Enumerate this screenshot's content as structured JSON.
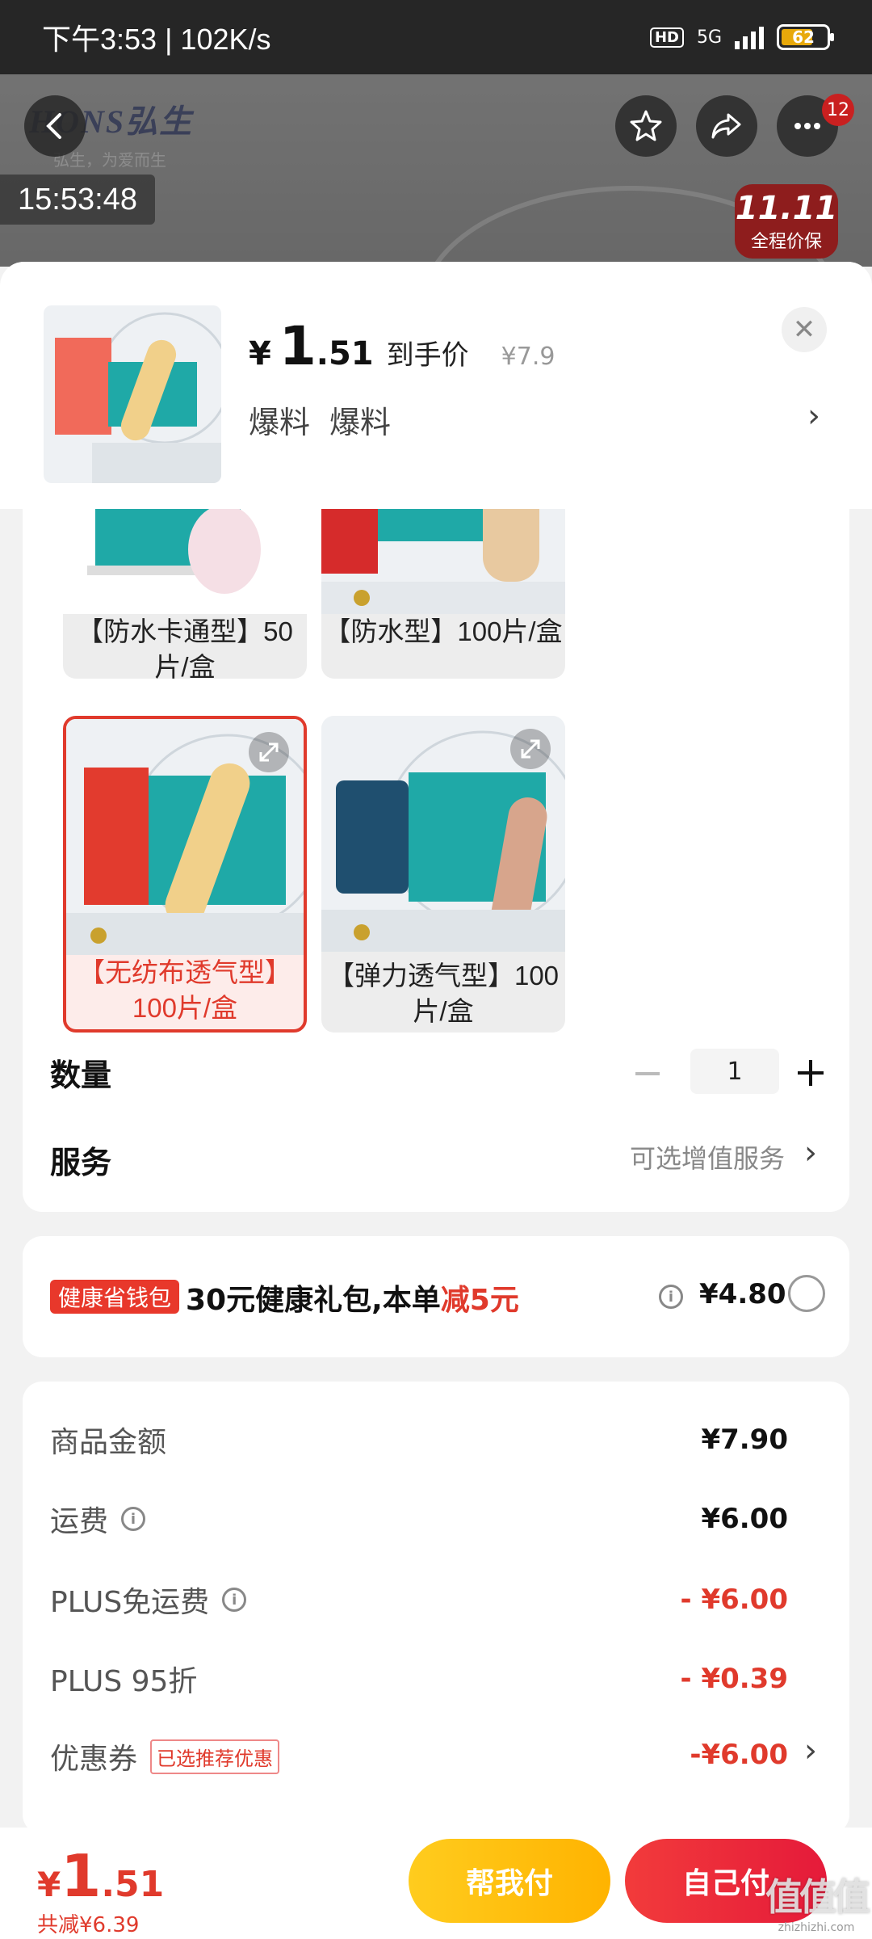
{
  "status_bar": {
    "time": "下午3:53 | 102K/s",
    "hd": "HD",
    "network": "5G",
    "battery": "62"
  },
  "background": {
    "logo": "HONS弘生",
    "slogan": "弘生，为爱而生",
    "clock_overlay": "15:53:48",
    "promo_big": "11.11",
    "promo_small": "全程价保",
    "notification_count": "12"
  },
  "sheet": {
    "price": {
      "yen": "¥",
      "integer": "1",
      "decimal": ".51",
      "label": "到手价",
      "original": "¥7.9"
    },
    "tags": [
      "爆料",
      "爆料"
    ]
  },
  "variants": [
    {
      "label": "【防水卡通型】50片/盒",
      "selected": false
    },
    {
      "label": "【防水型】100片/盒",
      "selected": false
    },
    {
      "label": "【无纺布透气型】100片/盒",
      "selected": true
    },
    {
      "label": "【弹力透气型】100片/盒",
      "selected": false
    }
  ],
  "quantity": {
    "label": "数量",
    "value": "1"
  },
  "service": {
    "label": "服务",
    "hint": "可选增值服务"
  },
  "health": {
    "badge": "健康省钱包",
    "text_prefix": "30元健康礼包,本单",
    "text_red": "减5元",
    "price": "¥4.80"
  },
  "costs": [
    {
      "label": "商品金额",
      "value": "¥7.90",
      "red": false,
      "info": false
    },
    {
      "label": "运费",
      "value": "¥6.00",
      "red": false,
      "info": true
    },
    {
      "label": "PLUS免运费",
      "value": "- ¥6.00",
      "red": true,
      "info": true
    },
    {
      "label": "PLUS 95折",
      "value": "- ¥0.39",
      "red": true,
      "info": false
    },
    {
      "label": "优惠券",
      "value": "-¥6.00",
      "red": true,
      "info": false,
      "tag": "已选推荐优惠"
    }
  ],
  "bottom": {
    "yen": "¥",
    "integer": "1",
    "decimal": ".51",
    "saved": "共减¥6.39",
    "help_pay": "帮我付",
    "self_pay": "自己付"
  },
  "watermark": {
    "main": "值值值",
    "sub": "zhizhizhi.com"
  },
  "colors": {
    "accent_red": "#e03a2c",
    "yellow_button": "#ffc107",
    "red_button": "#eb2a3a"
  }
}
